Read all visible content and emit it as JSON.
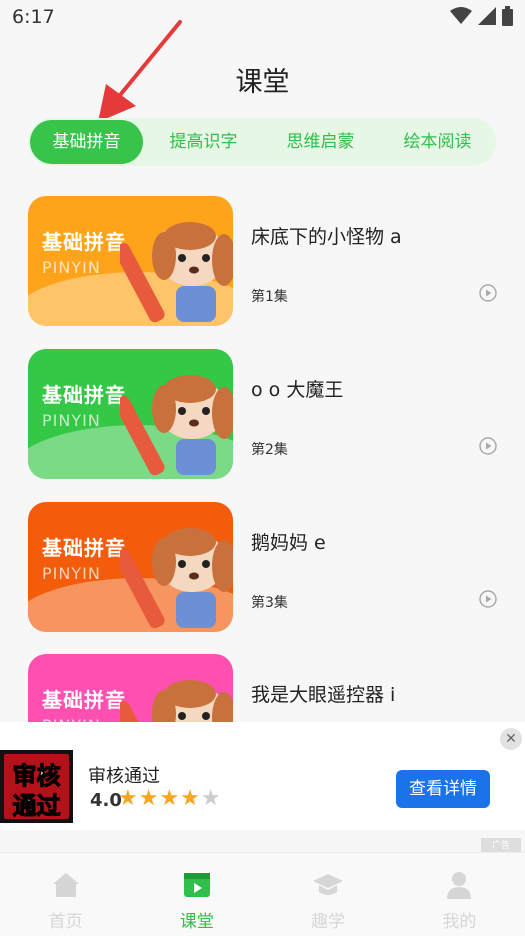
{
  "status": {
    "time": "6:17"
  },
  "page": {
    "title": "课堂"
  },
  "tabs": [
    {
      "label": "基础拼音",
      "active": true
    },
    {
      "label": "提高识字",
      "active": false
    },
    {
      "label": "思维启蒙",
      "active": false
    },
    {
      "label": "绘本阅读",
      "active": false
    }
  ],
  "lessons": [
    {
      "thumb_title": "基础拼音",
      "thumb_subtitle": "PINYIN",
      "name": "床底下的小怪物 a",
      "episode": "第1集",
      "color": "#ffa41a"
    },
    {
      "thumb_title": "基础拼音",
      "thumb_subtitle": "PINYIN",
      "name": "o o 大魔王",
      "episode": "第2集",
      "color": "#35c746"
    },
    {
      "thumb_title": "基础拼音",
      "thumb_subtitle": "PINYIN",
      "name": "鹅妈妈 e",
      "episode": "第3集",
      "color": "#f25c0a"
    },
    {
      "thumb_title": "基础拼音",
      "thumb_subtitle": "PINYIN",
      "name": "我是大眼遥控器 i",
      "episode": "",
      "color": "#ff4fb0"
    }
  ],
  "ad": {
    "logo_line1": "审核",
    "logo_line2": "通过",
    "title": "审核通过",
    "rating": "4.0",
    "rating_value": 4,
    "rating_max": 5,
    "button_label": "查看详情",
    "tag": "广告"
  },
  "nav": [
    {
      "label": "首页",
      "icon": "home-icon",
      "active": false
    },
    {
      "label": "课堂",
      "icon": "video-play-icon",
      "active": true
    },
    {
      "label": "趣学",
      "icon": "graduation-cap-icon",
      "active": false
    },
    {
      "label": "我的",
      "icon": "user-icon",
      "active": false
    }
  ],
  "colors": {
    "accent": "#38c34a",
    "ad_button": "#1a73e8",
    "star": "#f5a623"
  }
}
